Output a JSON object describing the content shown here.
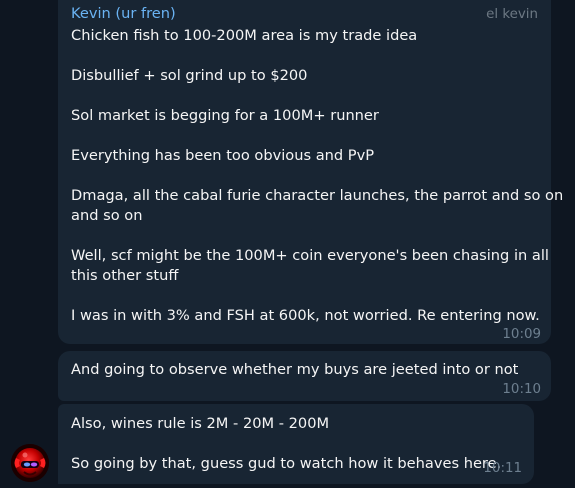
{
  "messages": [
    {
      "sender": "Kevin (ur fren)",
      "rank": "el kevin",
      "lines": [
        "Chicken fish to 100-200M area is my trade idea",
        "Disbullief + sol grind up to $200",
        "Sol market is begging for a 100M+ runner",
        "Everything has been too obvious and PvP",
        "Dmaga, all the cabal furie character launches, the parrot and so on",
        "and so on",
        "Well, scf might be the 100M+ coin everyone's been chasing in all",
        "this other stuff",
        "I was in with 3% and FSH at 600k, not worried. Re entering now."
      ],
      "time": "10:09"
    },
    {
      "lines": [
        "And going to observe whether my buys are jeeted into or not"
      ],
      "time": "10:10"
    },
    {
      "lines": [
        "Also, wines rule is 2M - 20M - 200M",
        "So going by that, guess gud to watch how it behaves here."
      ],
      "time": "10:11"
    }
  ],
  "avatar": {
    "icon": "red-helmet-avatar-icon"
  },
  "colors": {
    "background": "#0e1621",
    "bubble": "#182533",
    "sender": "#6ab3f3",
    "text": "#f5f5f5",
    "time": "#6d7f8f"
  }
}
